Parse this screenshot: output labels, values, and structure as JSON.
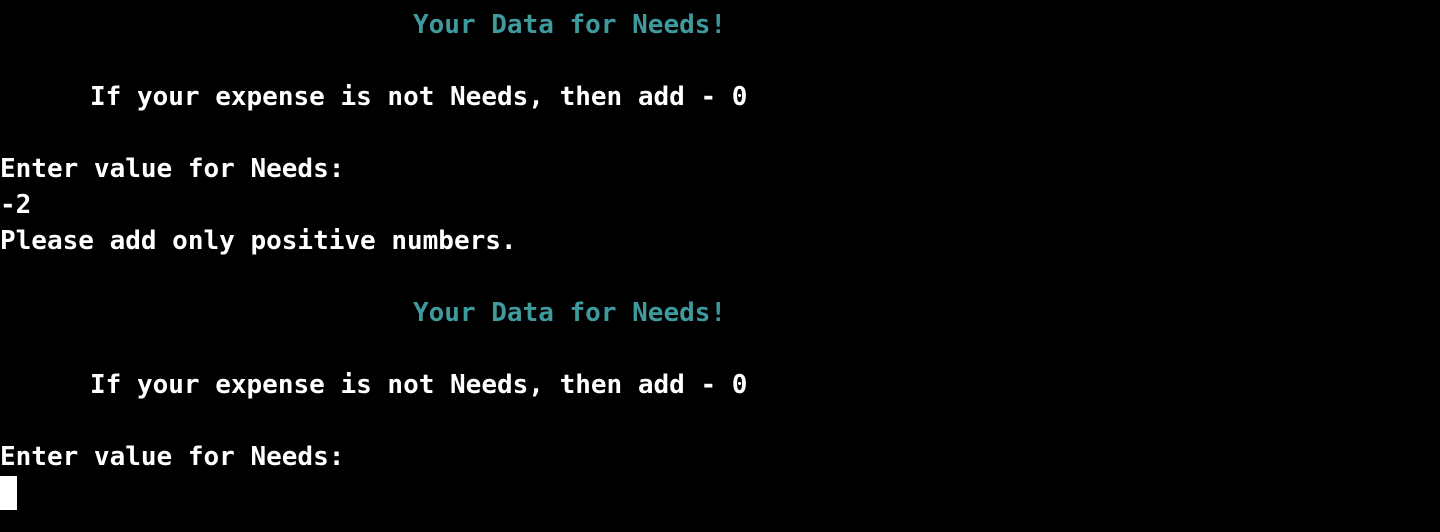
{
  "terminal": {
    "block1": {
      "heading": "Your Data for Needs!",
      "hint": "If your expense is not Needs, then add - 0",
      "prompt": "Enter value for Needs:",
      "input": "-2",
      "error": "Please add only positive numbers."
    },
    "block2": {
      "heading": "Your Data for Needs!",
      "hint": "If your expense is not Needs, then add - 0",
      "prompt": "Enter value for Needs:"
    },
    "colors": {
      "background": "#000000",
      "text": "#ffffff",
      "heading": "#3f9a9e"
    }
  }
}
